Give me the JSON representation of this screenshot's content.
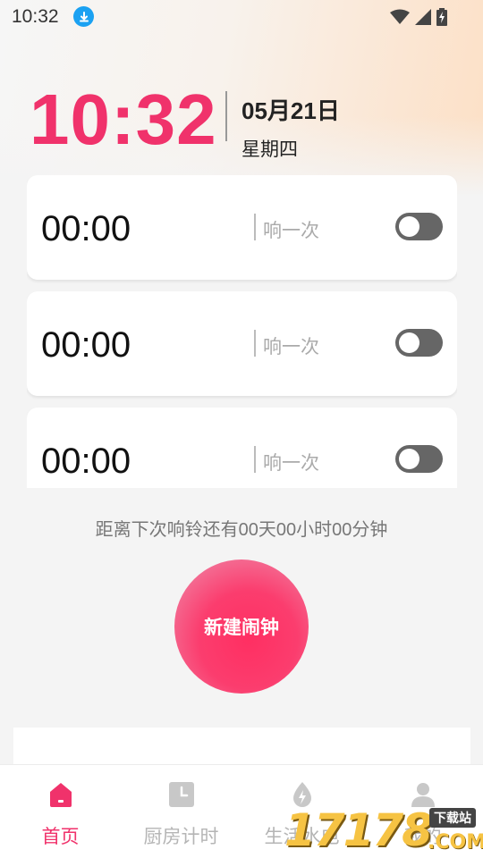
{
  "status_bar": {
    "time": "10:32",
    "icons": [
      "download-icon",
      "wifi-icon",
      "cellular-signal-icon",
      "battery-charging-icon"
    ]
  },
  "header": {
    "clock": "10:32",
    "date": "05月21日",
    "weekday": "星期四"
  },
  "alarms": [
    {
      "time": "00:00",
      "repeat": "响一次",
      "enabled": false
    },
    {
      "time": "00:00",
      "repeat": "响一次",
      "enabled": false
    },
    {
      "time": "00:00",
      "repeat": "响一次",
      "enabled": false
    }
  ],
  "next_ring": "距离下次响铃还有00天00小时00分钟",
  "new_alarm_button": "新建闹钟",
  "bottom_nav": [
    {
      "label": "首页",
      "icon": "home-icon",
      "active": true
    },
    {
      "label": "厨房计时",
      "icon": "clock-icon",
      "active": false
    },
    {
      "label": "生活水电",
      "icon": "power-icon",
      "active": false
    },
    {
      "label": "我的",
      "icon": "user-icon",
      "active": false
    }
  ],
  "watermark": {
    "digits": "17178",
    "suffix": ".COM",
    "tag": "下载站"
  },
  "colors": {
    "accent": "#f0326b",
    "inactive": "#b5b5b5",
    "toggle_off": "#666666"
  }
}
